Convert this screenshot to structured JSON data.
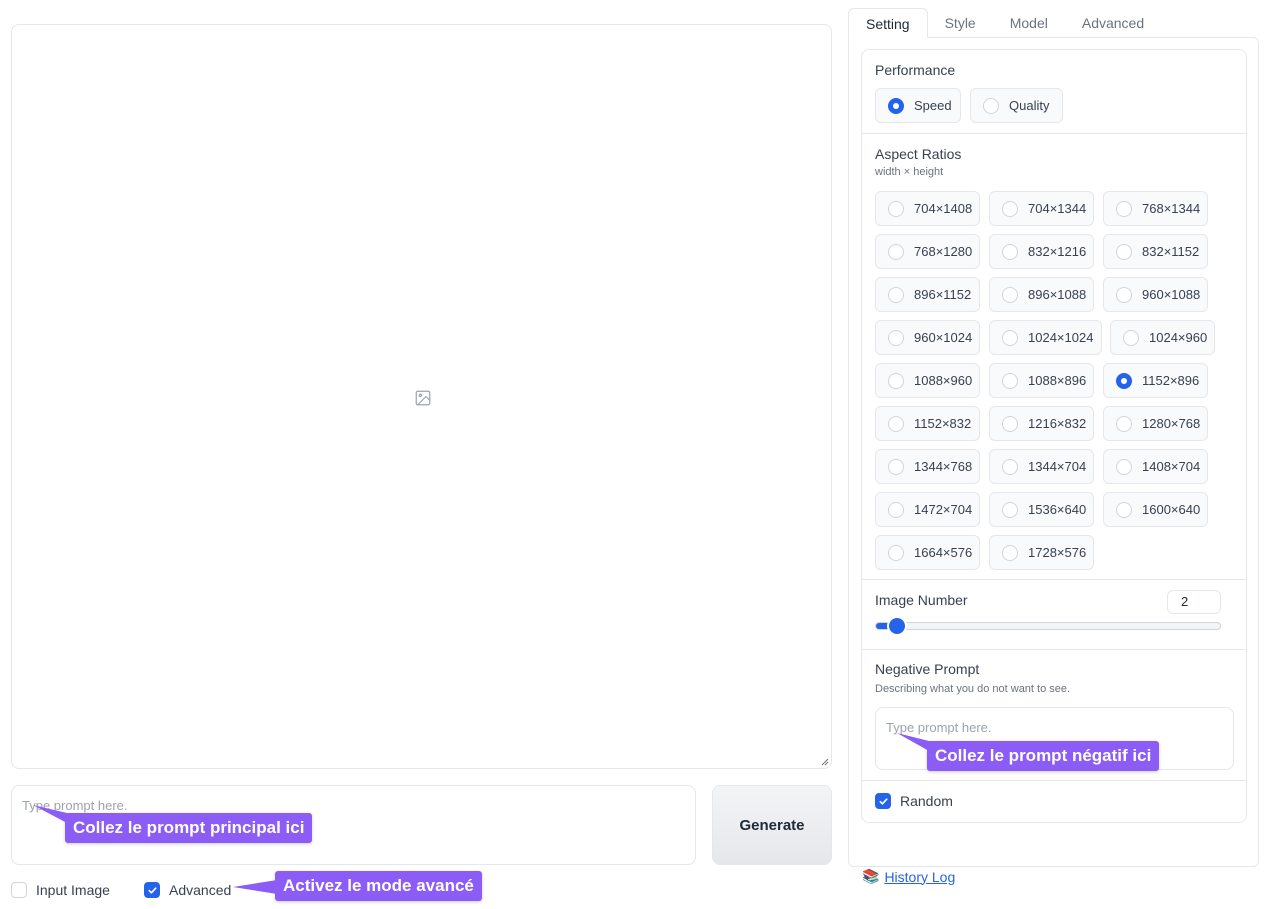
{
  "main": {
    "prompt_placeholder": "Type prompt here.",
    "generate_label": "Generate",
    "input_image_label": "Input Image",
    "input_image_checked": false,
    "advanced_label": "Advanced",
    "advanced_checked": true
  },
  "callouts": {
    "prompt": "Collez le prompt principal ici",
    "advanced": "Activez le mode avancé",
    "negative": "Collez le prompt négatif ici"
  },
  "tabs": [
    {
      "label": "Setting",
      "active": true
    },
    {
      "label": "Style",
      "active": false
    },
    {
      "label": "Model",
      "active": false
    },
    {
      "label": "Advanced",
      "active": false
    }
  ],
  "performance": {
    "label": "Performance",
    "options": [
      {
        "label": "Speed",
        "selected": true
      },
      {
        "label": "Quality",
        "selected": false
      }
    ]
  },
  "aspect_ratios": {
    "label": "Aspect Ratios",
    "sublabel": "width × height",
    "options": [
      "704×1408",
      "704×1344",
      "768×1344",
      "768×1280",
      "832×1216",
      "832×1152",
      "896×1152",
      "896×1088",
      "960×1088",
      "960×1024",
      "1024×1024",
      "1024×960",
      "1088×960",
      "1088×896",
      "1152×896",
      "1152×832",
      "1216×832",
      "1280×768",
      "1344×768",
      "1344×704",
      "1408×704",
      "1472×704",
      "1536×640",
      "1600×640",
      "1664×576",
      "1728×576"
    ],
    "selected": "1152×896"
  },
  "image_number": {
    "label": "Image Number",
    "value": "2",
    "min": 1,
    "max": 32
  },
  "negative_prompt": {
    "label": "Negative Prompt",
    "sublabel": "Describing what you do not want to see.",
    "placeholder": "Type prompt here."
  },
  "random": {
    "label": "Random",
    "checked": true
  },
  "history": {
    "icon": "📚",
    "label": "History Log"
  },
  "colors": {
    "accent": "#2563eb",
    "callout": "#8b5cf6"
  }
}
